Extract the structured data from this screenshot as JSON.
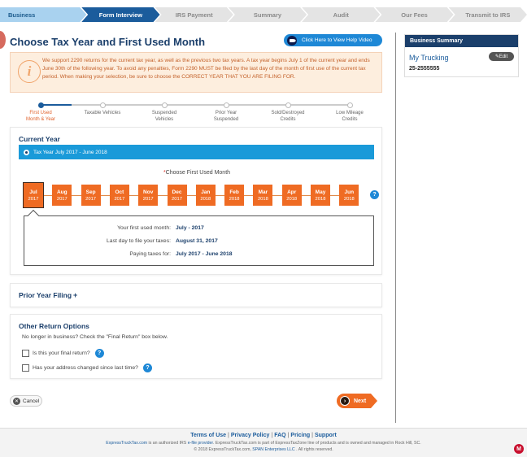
{
  "steps": [
    {
      "label": "Business",
      "state": "done"
    },
    {
      "label": "Form Interview",
      "state": "active"
    },
    {
      "label": "IRS Payment",
      "state": "todo"
    },
    {
      "label": "Summary",
      "state": "todo"
    },
    {
      "label": "Audit",
      "state": "todo"
    },
    {
      "label": "Our Fees",
      "state": "todo"
    },
    {
      "label": "Transmit to IRS",
      "state": "todo"
    }
  ],
  "page": {
    "title": "Choose Tax Year and First Used Month",
    "help_button": "Click Here to View Help Video"
  },
  "notice": {
    "icon": "info-i-icon",
    "text": "We support 2290 returns for the current tax year, as well as the previous two tax years. A tax year begins July 1 of the current year and ends June 30th of the following year. To avoid any penalties, Form 2290 MUST be filed by the last day of the month of first use of the current tax period. When making your selection, be sure to choose the CORRECT YEAR THAT YOU ARE FILING FOR."
  },
  "tracker": [
    {
      "l1": "First Used",
      "l2": "Month & Year",
      "current": true
    },
    {
      "l1": "Taxable Vehicles",
      "l2": "",
      "current": false
    },
    {
      "l1": "Suspended",
      "l2": "Vehicles",
      "current": false
    },
    {
      "l1": "Prior Year",
      "l2": "Suspended",
      "current": false
    },
    {
      "l1": "Sold/Destroyed",
      "l2": "Credits",
      "current": false
    },
    {
      "l1": "Low Mileage",
      "l2": "Credits",
      "current": false
    }
  ],
  "current_year": {
    "title": "Current Year",
    "tax_year": "Tax Year July 2017 - June 2018",
    "choose_label": "Choose First Used Month",
    "required_mark": "*",
    "months": [
      {
        "m": "Jul",
        "y": "2017",
        "selected": true
      },
      {
        "m": "Aug",
        "y": "2017"
      },
      {
        "m": "Sep",
        "y": "2017"
      },
      {
        "m": "Oct",
        "y": "2017"
      },
      {
        "m": "Nov",
        "y": "2017"
      },
      {
        "m": "Dec",
        "y": "2017"
      },
      {
        "m": "Jan",
        "y": "2018"
      },
      {
        "m": "Feb",
        "y": "2018"
      },
      {
        "m": "Mar",
        "y": "2018"
      },
      {
        "m": "Apr",
        "y": "2018"
      },
      {
        "m": "May",
        "y": "2018"
      },
      {
        "m": "Jun",
        "y": "2018"
      }
    ],
    "help_mark": "?",
    "summary": [
      {
        "k": "Your first used month:",
        "v": "July - 2017"
      },
      {
        "k": "Last day to file your taxes:",
        "v": "August 31, 2017"
      },
      {
        "k": "Paying taxes for:",
        "v": "July 2017 - June 2018"
      }
    ]
  },
  "prior_year": {
    "title": "Prior Year Filing",
    "plus": "+"
  },
  "other_options": {
    "title": "Other Return Options",
    "subtitle": "No longer in business? Check the \"Final Return\" box below.",
    "final_return": "Is this your final return?",
    "address_changed": "Has your address changed since last time?"
  },
  "buttons": {
    "cancel": "Cancel",
    "next": "Next"
  },
  "business_summary": {
    "title": "Business Summary",
    "name": "My Trucking",
    "ein": "25-2555555",
    "edit": "Edit"
  },
  "footer": {
    "links": [
      "Terms of Use",
      "Privacy Policy",
      "FAQ",
      "Pricing",
      "Support"
    ],
    "line2_a": "ExpressTruckTax.com",
    "line2_b": " is an authorized IRS ",
    "line2_c": "e-file provider",
    "line2_d": ". ExpressTruckTax.com is part of ExpressTaxZone line of products and is owned and managed in Rock Hill, SC.",
    "line3_a": "© 2018 ExpressTruckTax.com, ",
    "line3_b": "SPAN Enterprises LLC",
    "line3_c": " . All rights reserved.",
    "badge": "M"
  },
  "colors": {
    "navy": "#1b3f6b",
    "orange": "#ef6b23",
    "blue": "#1a9ad9",
    "notice_bg": "#fdeede"
  }
}
